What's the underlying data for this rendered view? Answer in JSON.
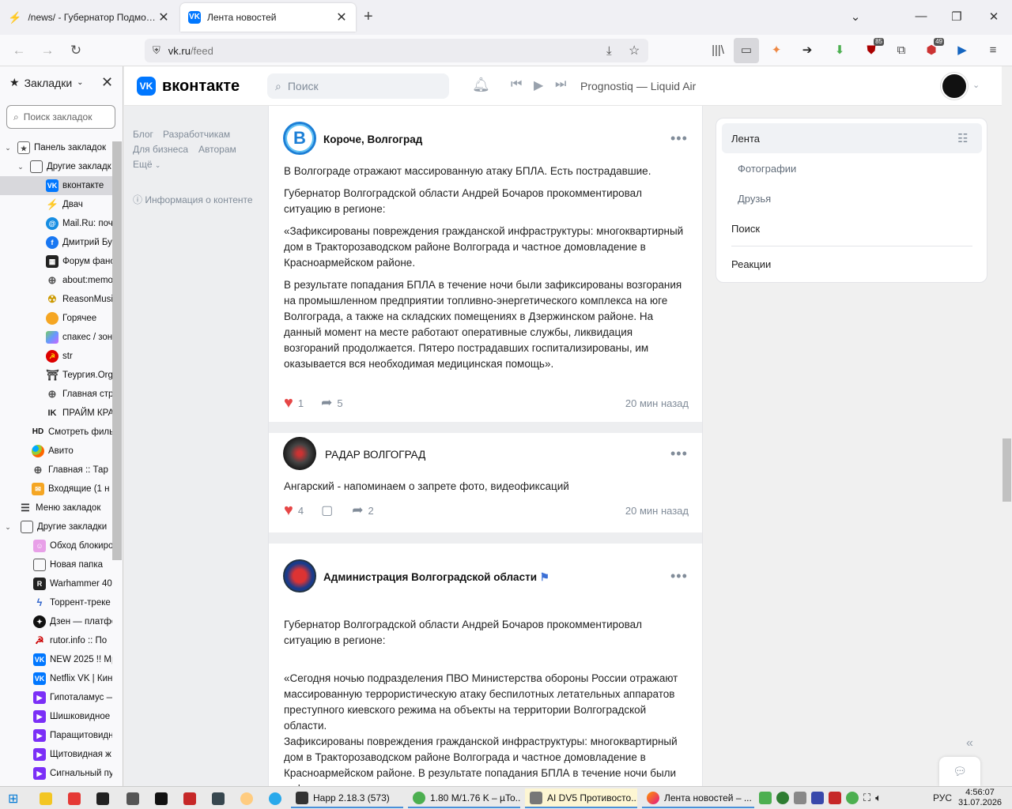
{
  "browser": {
    "tabs": [
      {
        "title": "/news/ - Губернатор Подмосковья",
        "active": false
      },
      {
        "title": "Лента новостей",
        "active": true
      }
    ],
    "new_tab_icon": "plus-icon",
    "url_host": "vk.ru",
    "url_path": "/feed"
  },
  "bookmarks": {
    "header": "Закладки",
    "search_placeholder": "Поиск закладок",
    "items": [
      {
        "label": "Панель закладок"
      },
      {
        "label": "Другие закладк"
      },
      {
        "label": "вконтакте"
      },
      {
        "label": "Двач"
      },
      {
        "label": "Mail.Ru: поч"
      },
      {
        "label": "Дмитрий Бу"
      },
      {
        "label": "Форум фано"
      },
      {
        "label": "about:memo"
      },
      {
        "label": "ReasonMusic"
      },
      {
        "label": "Горячее"
      },
      {
        "label": "спакес / зон"
      },
      {
        "label": "str"
      },
      {
        "label": "Теургия.Org"
      },
      {
        "label": "Главная стр"
      },
      {
        "label": "ПРАЙМ КРА"
      },
      {
        "label": "Смотреть филь"
      },
      {
        "label": "Авито"
      },
      {
        "label": "Главная :: Тар"
      },
      {
        "label": "Входящие (1 н"
      },
      {
        "label": "Меню закладок"
      },
      {
        "label": "Другие закладки"
      },
      {
        "label": "Обход блокиро"
      },
      {
        "label": "Новая папка"
      },
      {
        "label": "Warhammer 40"
      },
      {
        "label": "Торрент-треке"
      },
      {
        "label": "Дзен — платфо"
      },
      {
        "label": "rutor.info :: По"
      },
      {
        "label": "NEW 2025 !! Mp"
      },
      {
        "label": "Netflix VK | Кин"
      },
      {
        "label": "Гипоталамус —"
      },
      {
        "label": "Шишковидное"
      },
      {
        "label": "Паращитовидн"
      },
      {
        "label": "Щитовидная ж"
      },
      {
        "label": "Сигнальный пу"
      }
    ]
  },
  "vk": {
    "logo_text": "вконтакте",
    "search_placeholder": "Поиск",
    "now_playing": "Prognostiq — Liquid Air",
    "left_links": {
      "blog": "Блог",
      "developers": "Разработчикам",
      "business": "Для бизнеса",
      "authors": "Авторам",
      "more": "Ещё",
      "content_info": "Информация о контенте"
    },
    "posts": [
      {
        "author": "Короче, Волгоград",
        "paragraphs": [
          "В Волгограде отражают массированную атаку БПЛА. Есть пострадавшие.",
          "Губернатор Волгоградской области Андрей Бочаров прокомментировал ситуацию в регионе:",
          "«Зафиксированы повреждения гражданской инфраструктуры: многоквартирный дом в Тракторозаводском районе Волгограда и частное домовладение в Красноармейском районе.",
          "В результате попадания БПЛА в течение ночи были зафиксированы возгорания на промышленном предприятии топливно-энергетического комплекса на юге Волгограда, а также на складских помещениях в Дзержинском районе. На данный момент на месте работают оперативные службы, ликвидация возгораний продолжается. Пятеро пострадавших госпитализированы, им оказывается вся необходимая медицинская помощь»."
        ],
        "likes": "1",
        "shares": "5",
        "time": "20 мин назад"
      },
      {
        "author": "РАДАР ВОЛГОГРАД",
        "paragraphs": [
          "Ангарский - напоминаем о запрете фото, видеофиксаций"
        ],
        "likes": "4",
        "shares": "2",
        "time": "20 мин назад"
      },
      {
        "author": "Администрация Волгоградской области",
        "paragraphs": [
          "Губернатор Волгоградской области Андрей Бочаров прокомментировал ситуацию в регионе:",
          "«Сегодня ночью подразделения ПВО Министерства обороны России отражают массированную террористическую атаку беспилотных летательных аппаратов преступного киевского режима на объекты на территории Волгоградской области.\nЗафиксированы повреждения гражданской инфраструктуры: многоквартирный дом в Тракторозаводском районе Волгограда и частное домовладение в Красноармейском районе. В результате попадания БПЛА в течение ночи были зафиксированы возгорания на промышленном предприятии топливно-энергетического комплекса на юге Волгограда, а"
        ]
      }
    ],
    "right_menu": {
      "feed": "Лента",
      "photos": "Фотографии",
      "friends": "Друзья",
      "search": "Поиск",
      "reactions": "Реакции"
    }
  },
  "taskbar": {
    "apps": [
      {
        "label": "Нарр 2.18.3 (573)"
      },
      {
        "label": "1.80 M/1.76 K – µTo..."
      },
      {
        "label": "AI DV5 Противосто..."
      },
      {
        "label": "Лента новостей – ..."
      }
    ],
    "lang": "РУС",
    "time": "4:56:07",
    "date": "31.07.2026"
  },
  "colors": {
    "vk_blue": "#0077ff",
    "heart": "#e64646"
  }
}
